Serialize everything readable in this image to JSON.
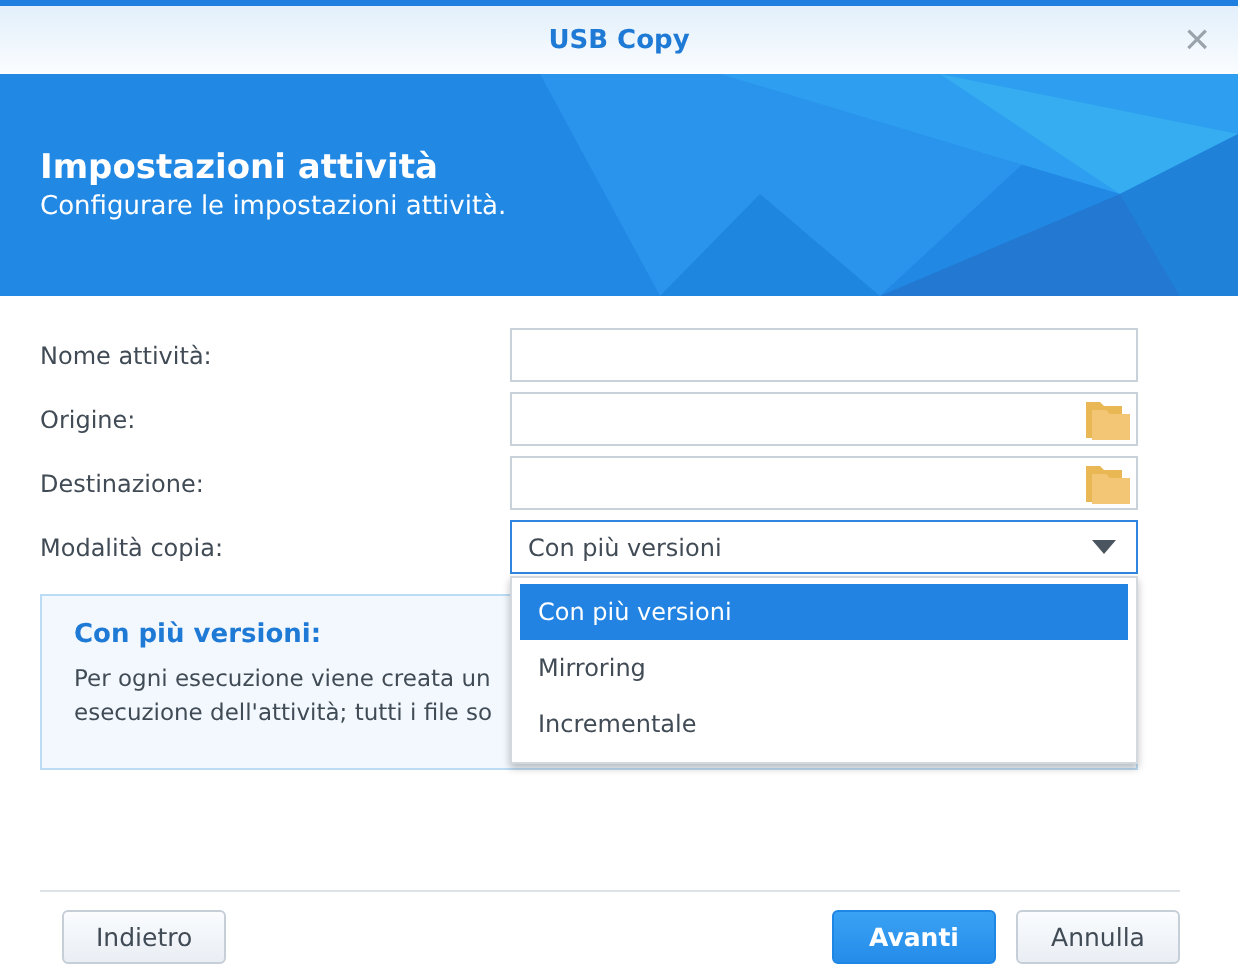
{
  "window": {
    "title": "USB Copy",
    "close": "×"
  },
  "banner": {
    "title": "Impostazioni attività",
    "subtitle": "Configurare le impostazioni attività."
  },
  "fields": [
    {
      "label": "Nome attività:",
      "kind": "text"
    },
    {
      "label": "Origine:",
      "kind": "folder"
    },
    {
      "label": "Destinazione:",
      "kind": "folder"
    },
    {
      "label": "Modalità copia:",
      "kind": "select",
      "value": "Con più versioni",
      "expanded": true
    }
  ],
  "dropdown_options": [
    {
      "label": "Con più versioni",
      "selected": true
    },
    {
      "label": "Mirroring",
      "selected": false
    },
    {
      "label": "Incrementale",
      "selected": false
    }
  ],
  "info": {
    "title": "Con più versioni:",
    "lines": [
      "Per ogni esecuzione viene creata un",
      "esecuzione dell'attività; tutti i file so"
    ]
  },
  "buttons": [
    {
      "label": "Indietro",
      "kind": "secondary"
    },
    {
      "label": "Avanti",
      "kind": "primary"
    },
    {
      "label": "Annulla",
      "kind": "secondary"
    }
  ]
}
